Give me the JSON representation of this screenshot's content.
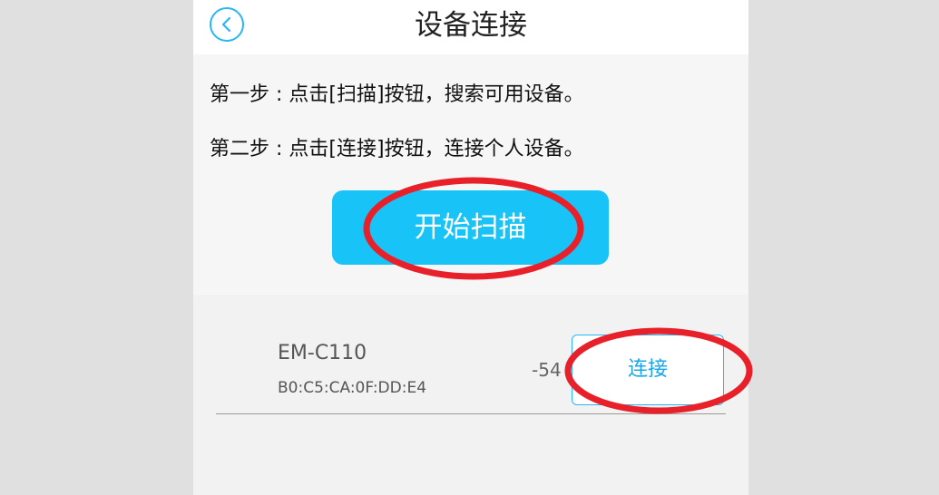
{
  "header": {
    "title": "设备连接",
    "back_icon": "chevron-left-icon"
  },
  "instructions": {
    "step1": "第一步 : 点击[扫描]按钮，搜索可用设备。",
    "step2": "第二步 : 点击[连接]按钮，连接个人设备。"
  },
  "scan_button": {
    "label": "开始扫描"
  },
  "devices": [
    {
      "name": "EM-C110",
      "mac": "B0:C5:CA:0F:DD:E4",
      "rssi": "-54",
      "connect_label": "连接"
    }
  ],
  "colors": {
    "accent": "#18c3f7",
    "annotation": "#e8202a"
  }
}
